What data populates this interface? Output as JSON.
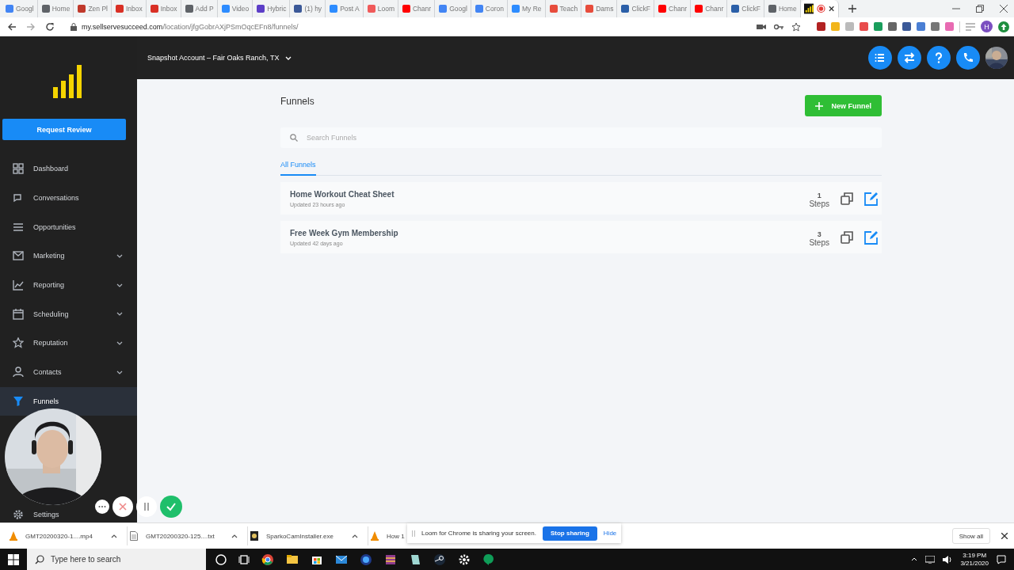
{
  "browser": {
    "tabs": [
      {
        "title": "Googl",
        "color": "#4285f4",
        "selected": false
      },
      {
        "title": "Home",
        "color": "#5f6368",
        "selected": false
      },
      {
        "title": "Zen Pl",
        "color": "#c0392b",
        "selected": false
      },
      {
        "title": "Inbox",
        "color": "#d93025",
        "selected": false
      },
      {
        "title": "Inbox",
        "color": "#d93025",
        "selected": false
      },
      {
        "title": "Add P",
        "color": "#5f6368",
        "selected": false
      },
      {
        "title": "Video",
        "color": "#2d8cff",
        "selected": false
      },
      {
        "title": "Hybric",
        "color": "#5c3ec7",
        "selected": false
      },
      {
        "title": "(1) hy",
        "color": "#3b5998",
        "selected": false
      },
      {
        "title": "Post A",
        "color": "#2d8cff",
        "selected": false
      },
      {
        "title": "Loom",
        "color": "#f05a5a",
        "selected": false
      },
      {
        "title": "Chanr",
        "color": "#ff0000",
        "selected": false
      },
      {
        "title": "Googl",
        "color": "#4285f4",
        "selected": false
      },
      {
        "title": "Coron",
        "color": "#4285f4",
        "selected": false
      },
      {
        "title": "My Re",
        "color": "#2d8cff",
        "selected": false
      },
      {
        "title": "Teach",
        "color": "#e74c3c",
        "selected": false
      },
      {
        "title": "Dams",
        "color": "#e74c3c",
        "selected": false
      },
      {
        "title": "ClickF",
        "color": "#2b5fa8",
        "selected": false
      },
      {
        "title": "Chanr",
        "color": "#ff0000",
        "selected": false
      },
      {
        "title": "Chanr",
        "color": "#ff0000",
        "selected": false
      },
      {
        "title": "ClickF",
        "color": "#2b5fa8",
        "selected": false
      },
      {
        "title": "Home",
        "color": "#5f6368",
        "selected": false
      },
      {
        "color": "#e53935",
        "selected": true
      }
    ],
    "url_host": "my.sellservesucceed.com",
    "url_path": "/location/jfgGobrAXjPSmOqcEFn8/funnels/",
    "profile": "H"
  },
  "app": {
    "account": "Snapshot Account – Fair Oaks Ranch, TX",
    "request_button": "Request Review",
    "nav": [
      {
        "label": "Dashboard",
        "expandable": false,
        "selected": false
      },
      {
        "label": "Conversations",
        "expandable": false,
        "selected": false
      },
      {
        "label": "Opportunities",
        "expandable": false,
        "selected": false
      },
      {
        "label": "Marketing",
        "expandable": true,
        "selected": false
      },
      {
        "label": "Reporting",
        "expandable": true,
        "selected": false
      },
      {
        "label": "Scheduling",
        "expandable": true,
        "selected": false
      },
      {
        "label": "Reputation",
        "expandable": true,
        "selected": false
      },
      {
        "label": "Contacts",
        "expandable": true,
        "selected": false
      },
      {
        "label": "Funnels",
        "expandable": false,
        "selected": true
      }
    ],
    "settings": "Settings",
    "page_title": "Funnels",
    "new_button": "New Funnel",
    "search": {
      "placeholder": "Search Funnels"
    },
    "tabs": [
      {
        "label": "All Funnels",
        "selected": true
      }
    ],
    "funnels": [
      {
        "name": "Home Workout Cheat Sheet",
        "updated": "Updated 23 hours ago",
        "steps": "1",
        "steps_label": "Steps"
      },
      {
        "name": "Free Week Gym Membership",
        "updated": "Updated 42 days ago",
        "steps": "3",
        "steps_label": "Steps"
      }
    ]
  },
  "downloads": {
    "items": [
      "GMT20200320-1....mp4",
      "GMT20200320-125....txt",
      "SparkoCamInstaller.exe",
      "How 1"
    ],
    "show_all": "Show all"
  },
  "loom": {
    "message": "Loom for Chrome is sharing your screen.",
    "stop": "Stop sharing",
    "hide": "Hide"
  },
  "taskbar": {
    "search_placeholder": "Type here to search",
    "time": "3:19 PM",
    "date": "3/21/2020"
  }
}
